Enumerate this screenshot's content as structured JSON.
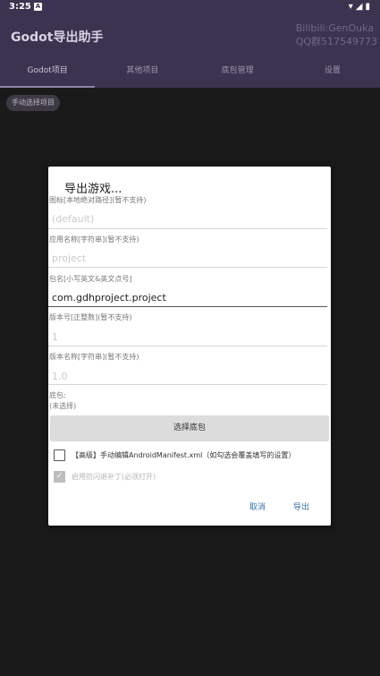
{
  "status_bar": {
    "time": "3:25",
    "notification_icon": "A",
    "right_icons": "▾◢▮"
  },
  "app_bar": {
    "title": "Godot导出助手",
    "watermark_line1": "Bilibili:GenOuka",
    "watermark_line2": "QQ群517549773"
  },
  "tabs": [
    {
      "label": "Godot项目",
      "active": true
    },
    {
      "label": "其他项目",
      "active": false
    },
    {
      "label": "底包管理",
      "active": false
    },
    {
      "label": "设置",
      "active": false
    }
  ],
  "chip_label": "手动选择项目",
  "dialog": {
    "title": "导出游戏...",
    "fields": [
      {
        "label": "图标[本地绝对路径](暂不支持)",
        "value": "(default)"
      },
      {
        "label": "应用名称[字符串](暂不支持)",
        "value": "project"
      },
      {
        "label": "包名[小写英文&英文点号]",
        "value": "com.gdhproject.project"
      },
      {
        "label": "版本号[正整数](暂不支持)",
        "value": "1"
      },
      {
        "label": "版本名称[字符串](暂不支持)",
        "value": "1.0"
      }
    ],
    "base_package_label": "底包:",
    "base_package_value": "(未选择)",
    "select_button": "选择底包",
    "checkbox_manifest": "【高级】手动编辑AndroidManifest.xml（如勾选会覆盖填写的设置）",
    "checkbox_patch": "启用防闪退补丁(必须打开)",
    "cancel_button": "取消",
    "export_button": "导出"
  }
}
